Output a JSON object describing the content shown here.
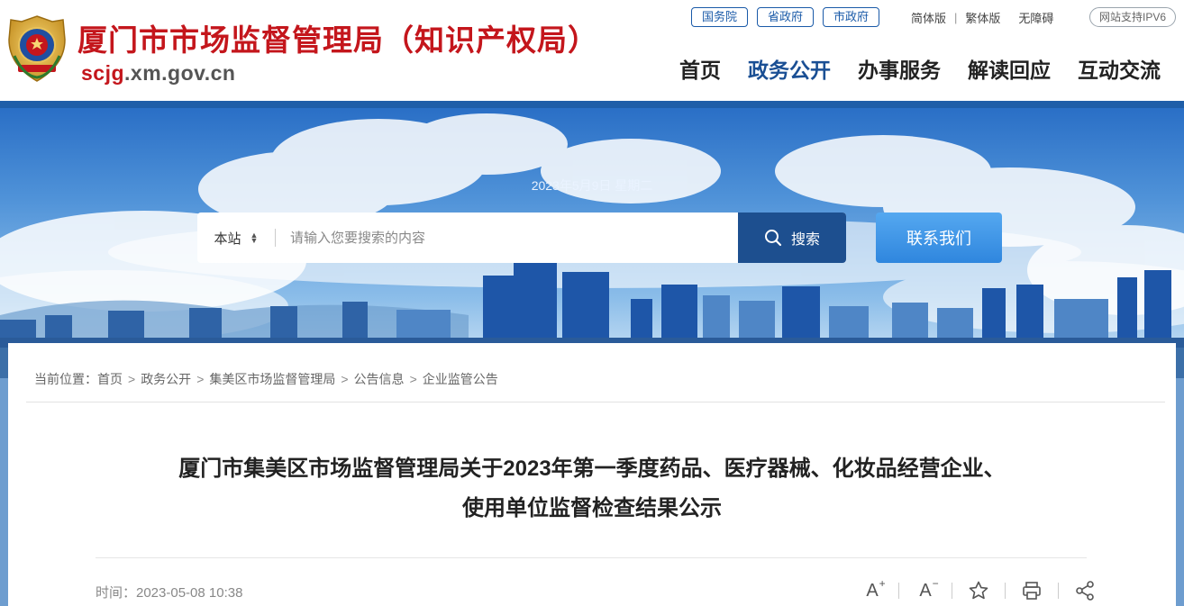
{
  "header": {
    "title": "厦门市市场监督管理局（知识产权局）",
    "domain_prefix": "scjg",
    "domain_suffix": ".xm.gov.cn",
    "gov_links": [
      "国务院",
      "省政府",
      "市政府"
    ],
    "version_links": {
      "simplified": "简体版",
      "traditional": "繁体版",
      "accessibility": "无障碍"
    },
    "ipv6_badge": "网站支持IPV6",
    "nav": [
      "首页",
      "政务公开",
      "办事服务",
      "解读回应",
      "互动交流"
    ],
    "active_nav": "政务公开"
  },
  "banner": {
    "date": "2023年5月9日 星期二",
    "search": {
      "scope": "本站",
      "placeholder": "请输入您要搜索的内容",
      "button": "搜索"
    },
    "contact_button": "联系我们"
  },
  "breadcrumb": {
    "prefix": "当前位置：",
    "items": [
      "首页",
      "政务公开",
      "集美区市场监督管理局",
      "公告信息",
      "企业监管公告"
    ]
  },
  "article": {
    "title_line1": "厦门市集美区市场监督管理局关于2023年第一季度药品、医疗器械、化妆品经营企业、",
    "title_line2": "使用单位监督检查结果公示",
    "time": "时间：2023-05-08 10:38"
  },
  "tools": {
    "font_up": "A",
    "font_down": "A",
    "plus": "+",
    "minus": "−"
  },
  "colors": {
    "brand_red": "#c4161c",
    "nav_blue": "#1a4f94",
    "header_bar": "#1f5ea8",
    "search_button": "#1d4f8f",
    "contact_button": "#2f86de"
  }
}
